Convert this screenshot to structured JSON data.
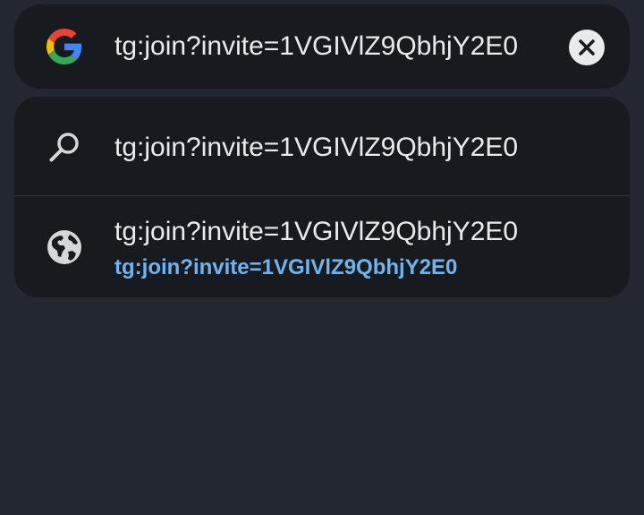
{
  "omnibox": {
    "query": "tg:join?invite=1VGIVlZ9QbhjY2E0",
    "logo_icon": "google-g-icon",
    "clear_icon": "close-icon"
  },
  "suggestions": [
    {
      "icon": "search-icon",
      "title": "tg:join?invite=1VGIVlZ9QbhjY2E0"
    },
    {
      "icon": "globe-icon",
      "title": "tg:join?invite=1VGIVlZ9QbhjY2E0",
      "url": "tg:join?invite=1VGIVlZ9QbhjY2E0"
    }
  ],
  "colors": {
    "background": "#232830",
    "panel": "#171b20",
    "text": "#e8eaed",
    "link": "#6fb3ef"
  }
}
